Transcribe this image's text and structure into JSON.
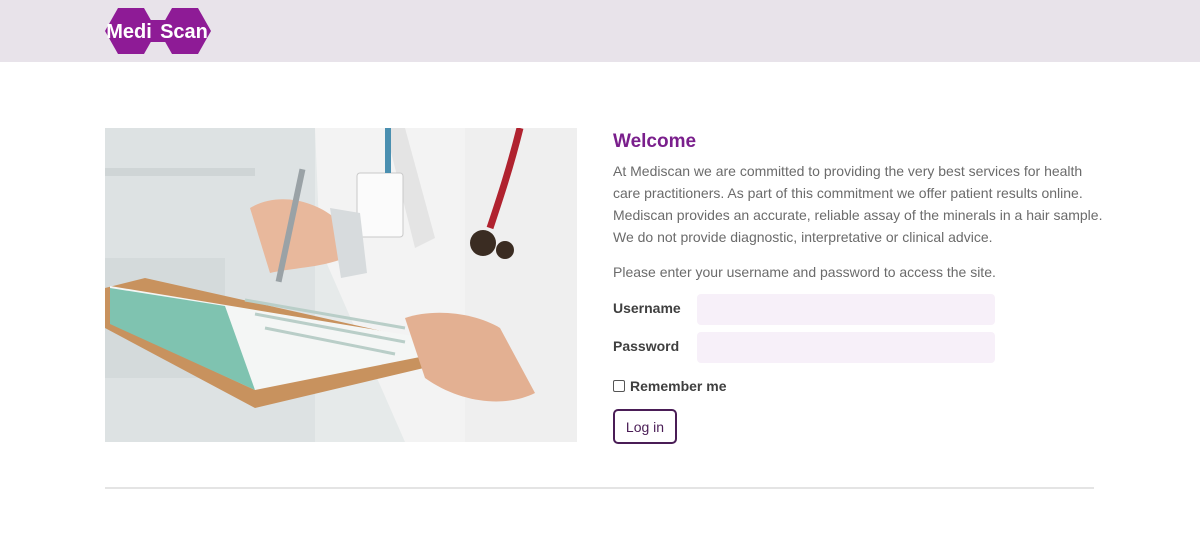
{
  "header": {
    "logo_text_left": "Medi",
    "logo_text_right": "Scan",
    "logo_color": "#8e1b96"
  },
  "photo": {
    "subject": "doctor-writing-on-clipboard"
  },
  "main": {
    "title": "Welcome",
    "intro": "At Mediscan we are committed to providing the very best services for health care practitioners. As part of this commitment we offer patient results online. Mediscan provides an accurate, reliable assay of the minerals in a hair sample. We do not provide diagnostic, interpretative or clinical advice.",
    "prompt": "Please enter your username and password to access the site.",
    "accent_color": "#7a1f8c"
  },
  "form": {
    "username_label": "Username",
    "username_value": "",
    "password_label": "Password",
    "password_value": "",
    "remember_label": "Remember me",
    "remember_checked": false,
    "login_label": "Log in"
  }
}
